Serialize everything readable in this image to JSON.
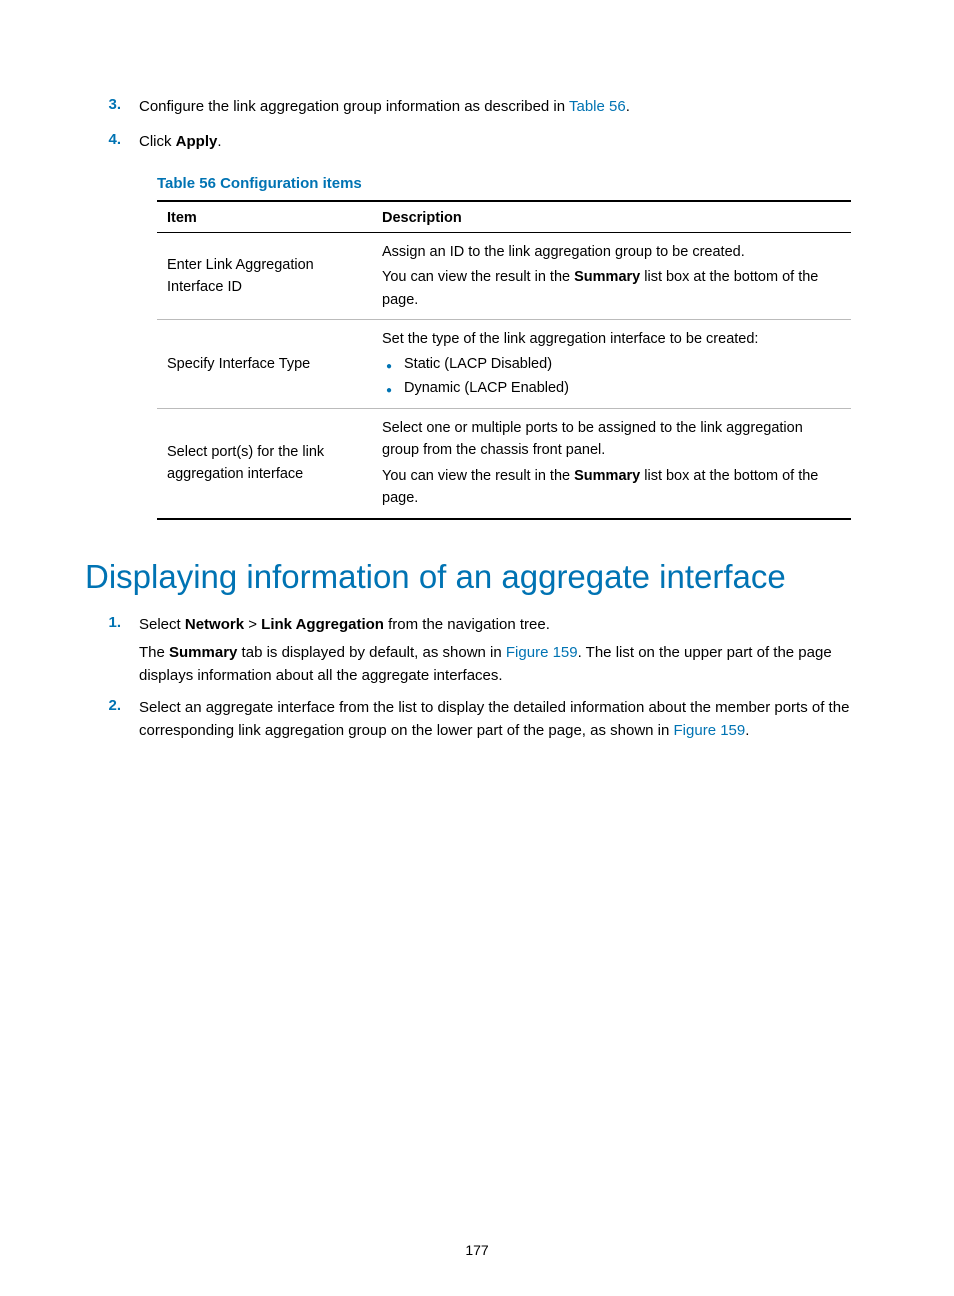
{
  "steps_top": {
    "s3": {
      "num": "3.",
      "text_before": "Configure the link aggregation group information as described in ",
      "link": "Table 56",
      "text_after": "."
    },
    "s4": {
      "num": "4.",
      "text_before": "Click ",
      "bold": "Apply",
      "text_after": "."
    }
  },
  "table": {
    "caption": "Table 56 Configuration items",
    "header_item": "Item",
    "header_desc": "Description",
    "r1_item": "Enter Link Aggregation Interface ID",
    "r1_desc_l1": "Assign an ID to the link aggregation group to be created.",
    "r1_desc_l2a": "You can view the result in the ",
    "r1_desc_l2b": "Summary",
    "r1_desc_l2c": " list box at the bottom of the page.",
    "r2_item": "Specify Interface Type",
    "r2_desc_intro": "Set the type of the link aggregation interface to be created:",
    "r2_b1": "Static (LACP Disabled)",
    "r2_b2": "Dynamic (LACP Enabled)",
    "r3_item": "Select port(s) for the link aggregation interface",
    "r3_desc_l1": "Select one or multiple ports to be assigned to the link aggregation group from the chassis front panel.",
    "r3_desc_l2a": "You can view the result in the ",
    "r3_desc_l2b": "Summary",
    "r3_desc_l2c": " list box at the bottom of the page."
  },
  "heading": "Displaying information of an aggregate interface",
  "steps_bottom": {
    "s1": {
      "num": "1.",
      "line1a": "Select ",
      "line1b": "Network",
      "line1c": " > ",
      "line1d": "Link Aggregation",
      "line1e": " from the navigation tree.",
      "line2a": "The ",
      "line2b": "Summary",
      "line2c": " tab is displayed by default, as shown in ",
      "line2d": "Figure 159",
      "line2e": ". The list on the upper part of the page displays information about all the aggregate interfaces."
    },
    "s2": {
      "num": "2.",
      "text_a": "Select an aggregate interface from the list to display the detailed information about the member ports of the corresponding link aggregation group on the lower part of the page, as shown in ",
      "text_link": "Figure 159",
      "text_b": "."
    }
  },
  "page_number": "177"
}
